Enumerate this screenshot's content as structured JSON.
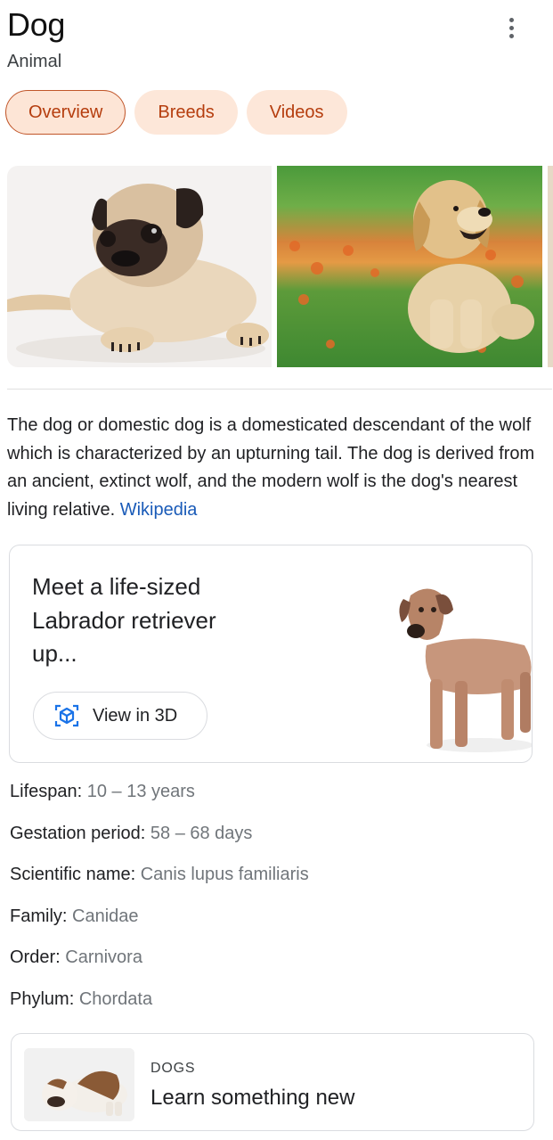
{
  "header": {
    "title": "Dog",
    "subtitle": "Animal",
    "more_icon": "more-vert-icon"
  },
  "tabs": [
    {
      "label": "Overview",
      "active": true
    },
    {
      "label": "Breeds",
      "active": false
    },
    {
      "label": "Videos",
      "active": false
    }
  ],
  "images": [
    {
      "subject": "pug puppy lying down"
    },
    {
      "subject": "golden retriever puppy sitting in flower field"
    }
  ],
  "description": {
    "text": "The dog or domestic dog is a domesticated descendant of the wolf which is characterized by an upturning tail. The dog is derived from an ancient, extinct wolf, and the modern wolf is the dog's nearest living relative.",
    "source_link": "Wikipedia",
    "link_color": "#1a5bb8"
  },
  "view3d": {
    "title": "Meet a life-sized Labrador retriever up...",
    "button_label": "View in 3D",
    "button_icon": "cube-3d-icon"
  },
  "facts": [
    {
      "label": "Lifespan:",
      "value": "10 – 13 years"
    },
    {
      "label": "Gestation period:",
      "value": "58 – 68 days"
    },
    {
      "label": "Scientific name:",
      "value": "Canis lupus familiaris"
    },
    {
      "label": "Family:",
      "value": "Canidae"
    },
    {
      "label": "Order:",
      "value": "Carnivora"
    },
    {
      "label": "Phylum:",
      "value": "Chordata"
    }
  ],
  "related_card": {
    "kicker": "DOGS",
    "title": "Learn something new"
  },
  "colors": {
    "chip_bg": "#fde7d9",
    "chip_text": "#b53d0e",
    "fact_value": "#70757a"
  }
}
